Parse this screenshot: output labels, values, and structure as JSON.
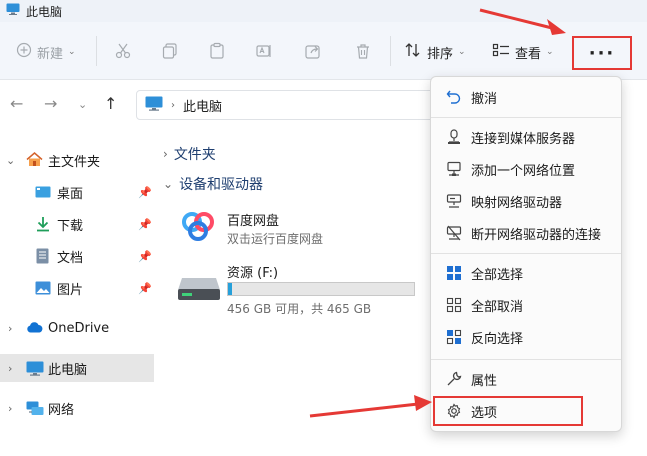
{
  "window": {
    "title": "此电脑"
  },
  "toolbar": {
    "new_label": "新建",
    "sort_label": "排序",
    "view_label": "查看",
    "more_label": "···"
  },
  "address": {
    "path": "此电脑"
  },
  "sidebar": {
    "items": [
      {
        "label": "主文件夹",
        "icon": "home-icon"
      },
      {
        "label": "桌面",
        "icon": "desktop-icon"
      },
      {
        "label": "下载",
        "icon": "download-icon"
      },
      {
        "label": "文档",
        "icon": "document-icon"
      },
      {
        "label": "图片",
        "icon": "picture-icon"
      },
      {
        "label": "OneDrive",
        "icon": "cloud-icon"
      },
      {
        "label": "此电脑",
        "icon": "computer-icon"
      },
      {
        "label": "网络",
        "icon": "network-icon"
      }
    ]
  },
  "main": {
    "sections": [
      {
        "label": "文件夹"
      },
      {
        "label": "设备和驱动器"
      }
    ],
    "drives": [
      {
        "name": "百度网盘",
        "sub": "双击运行百度网盘",
        "icon": "baidu-netdisk-icon"
      },
      {
        "name": "资源 (F:)",
        "sub": "456 GB 可用，共 465 GB",
        "used_fraction": 0.019,
        "icon": "hard-drive-icon"
      }
    ]
  },
  "menu": {
    "items": [
      {
        "label": "撤消",
        "icon": "undo-icon"
      },
      {
        "label": "连接到媒体服务器",
        "icon": "media-server-icon"
      },
      {
        "label": "添加一个网络位置",
        "icon": "network-location-icon"
      },
      {
        "label": "映射网络驱动器",
        "icon": "map-drive-icon"
      },
      {
        "label": "断开网络驱动器的连接",
        "icon": "disconnect-drive-icon"
      },
      {
        "label": "全部选择",
        "icon": "select-all-icon"
      },
      {
        "label": "全部取消",
        "icon": "select-none-icon"
      },
      {
        "label": "反向选择",
        "icon": "invert-selection-icon"
      },
      {
        "label": "属性",
        "icon": "wrench-icon"
      },
      {
        "label": "选项",
        "icon": "gear-icon"
      }
    ]
  },
  "colors": {
    "accent": "#26a0da",
    "highlight": "#e53935",
    "section_text": "#1f3f70"
  }
}
